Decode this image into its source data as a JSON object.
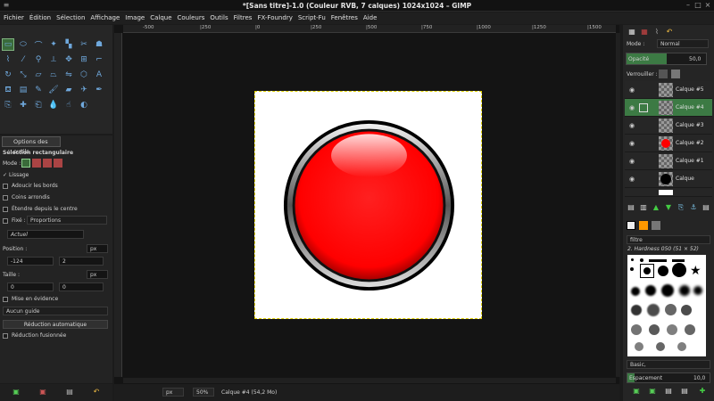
{
  "window": {
    "title": "*[Sans titre]-1.0 (Couleur RVB, 7 calques) 1024x1024 – GIMP"
  },
  "menu": [
    "Fichier",
    "Édition",
    "Sélection",
    "Affichage",
    "Image",
    "Calque",
    "Couleurs",
    "Outils",
    "Filtres",
    "FX-Foundry",
    "Script-Fu",
    "Fenêtres",
    "Aide"
  ],
  "tool_options": {
    "tab_label": "Options des outils",
    "tool_name": "Sélection rectangulaire",
    "mode_label": "Mode :",
    "antialias": "Lissage",
    "feather": "Adoucir les bords",
    "rounded": "Coins arrondis",
    "expand_center": "Étendre depuis le centre",
    "fixed_label": "Fixé :",
    "fixed_value": "Proportions",
    "ratio_value": "Actuel",
    "position_label": "Position :",
    "position_unit": "px",
    "pos_x": "-124",
    "pos_y": "2",
    "size_label": "Taille :",
    "size_unit": "px",
    "size_w": "0",
    "size_h": "0",
    "highlight": "Mise en évidence",
    "guide": "Aucun guide",
    "auto_shrink": "Réduction automatique",
    "merged_shrink": "Réduction fusionnée"
  },
  "rulers": {
    "h": [
      "-500",
      "|250",
      "|0",
      "|250",
      "|500",
      "|750",
      "|1000",
      "|1250",
      "|1500",
      "|1750"
    ],
    "v": [
      "2",
      "5",
      "0",
      "2",
      "5",
      "0",
      "5",
      "0",
      "0",
      "7",
      "5",
      "0",
      "1",
      "0",
      "0"
    ]
  },
  "status": {
    "unit": "px",
    "zoom": "50%",
    "layer": "Calque #4 (54,2 Mo)"
  },
  "layers_panel": {
    "mode_label": "Mode :",
    "mode_value": "Normal",
    "opacity_label": "Opacité",
    "opacity_value": "50,0",
    "opacity_fraction": 0.5,
    "lock_label": "Verrouiller :",
    "layers": [
      "Calque #5",
      "Calque #4",
      "Calque #3",
      "Calque #2",
      "Calque #1",
      "Calque",
      ""
    ]
  },
  "brushes_panel": {
    "filter_label": "filtre",
    "brush_name": "2. Hardness 050 (51 × 52)",
    "preset": "Basic,",
    "spacing_label": "Espacement",
    "spacing_value": "10,0"
  }
}
